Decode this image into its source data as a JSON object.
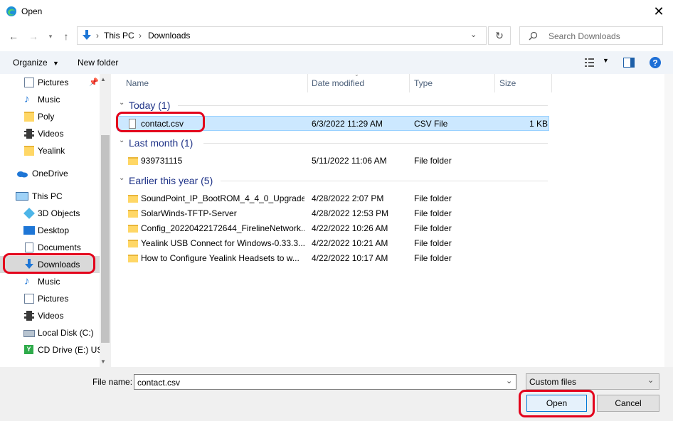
{
  "window": {
    "title": "Open"
  },
  "address": {
    "segments": [
      "This PC",
      "Downloads"
    ]
  },
  "search": {
    "placeholder": "Search Downloads"
  },
  "toolbar": {
    "organize": "Organize",
    "new_folder": "New folder"
  },
  "sidebar": {
    "items": [
      {
        "label": "Pictures",
        "icon": "pictures-icon",
        "pinned": true
      },
      {
        "label": "Music",
        "icon": "music-icon"
      },
      {
        "label": "Poly",
        "icon": "folder-icon"
      },
      {
        "label": "Videos",
        "icon": "videos-icon"
      },
      {
        "label": "Yealink",
        "icon": "folder-icon"
      },
      {
        "label": "OneDrive",
        "icon": "onedrive-icon"
      },
      {
        "label": "This PC",
        "icon": "this-pc-icon"
      },
      {
        "label": "3D Objects",
        "icon": "3d-objects-icon"
      },
      {
        "label": "Desktop",
        "icon": "desktop-icon"
      },
      {
        "label": "Documents",
        "icon": "documents-icon"
      },
      {
        "label": "Downloads",
        "icon": "downloads-icon",
        "selected": true
      },
      {
        "label": "Music",
        "icon": "music-icon"
      },
      {
        "label": "Pictures",
        "icon": "pictures-icon"
      },
      {
        "label": "Videos",
        "icon": "videos-icon"
      },
      {
        "label": "Local Disk (C:)",
        "icon": "local-disk-icon"
      },
      {
        "label": "CD Drive (E:) USB",
        "icon": "cd-drive-icon"
      }
    ]
  },
  "columns": {
    "name": "Name",
    "date": "Date modified",
    "type": "Type",
    "size": "Size"
  },
  "groups": [
    {
      "label": "Today (1)",
      "rows": [
        {
          "name": "contact.csv",
          "date": "6/3/2022 11:29 AM",
          "type": "CSV File",
          "size": "1 KB",
          "icon": "file-icon",
          "selected": true
        }
      ]
    },
    {
      "label": "Last month (1)",
      "rows": [
        {
          "name": "939731115",
          "date": "5/11/2022 11:06 AM",
          "type": "File folder",
          "size": "",
          "icon": "folder-icon"
        }
      ]
    },
    {
      "label": "Earlier this year (5)",
      "rows": [
        {
          "name": "SoundPoint_IP_BootROM_4_4_0_Upgrade...",
          "date": "4/28/2022 2:07 PM",
          "type": "File folder",
          "size": "",
          "icon": "folder-icon"
        },
        {
          "name": "SolarWinds-TFTP-Server",
          "date": "4/28/2022 12:53 PM",
          "type": "File folder",
          "size": "",
          "icon": "folder-icon"
        },
        {
          "name": "Config_20220422172644_FirelineNetwork...",
          "date": "4/22/2022 10:26 AM",
          "type": "File folder",
          "size": "",
          "icon": "folder-icon"
        },
        {
          "name": "Yealink USB Connect for Windows-0.33.3...",
          "date": "4/22/2022 10:21 AM",
          "type": "File folder",
          "size": "",
          "icon": "folder-icon"
        },
        {
          "name": "How to Configure Yealink Headsets to w...",
          "date": "4/22/2022 10:17 AM",
          "type": "File folder",
          "size": "",
          "icon": "folder-icon"
        }
      ]
    }
  ],
  "footer": {
    "filename_label": "File name:",
    "filename_value": "contact.csv",
    "filetype": "Custom files",
    "open": "Open",
    "cancel": "Cancel"
  },
  "colors": {
    "accent": "#0078d7",
    "highlight": "#e3001b",
    "selected_row": "#cce8ff",
    "group_header": "#1e3287"
  }
}
